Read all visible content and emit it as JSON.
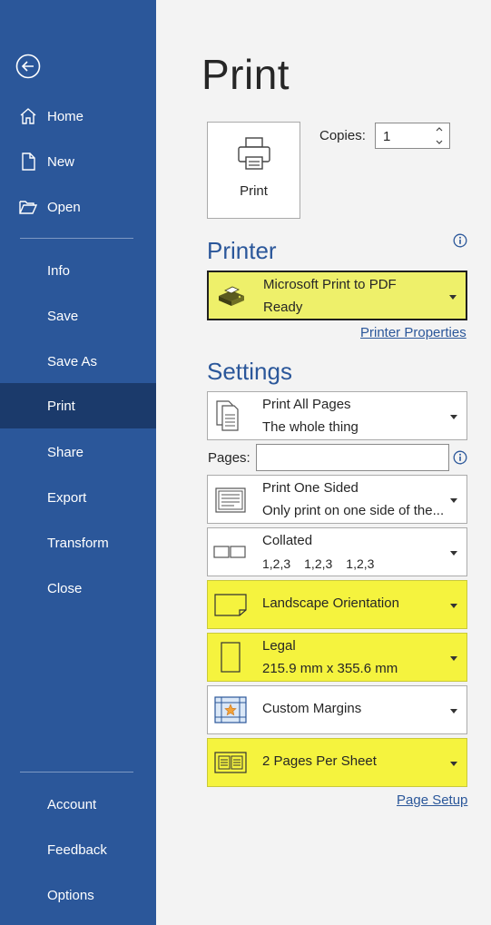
{
  "sidebar": {
    "top_items": [
      {
        "label": "Home",
        "icon": "home-icon"
      },
      {
        "label": "New",
        "icon": "new-document-icon"
      },
      {
        "label": "Open",
        "icon": "open-folder-icon"
      }
    ],
    "mid_items": [
      "Info",
      "Save",
      "Save As",
      "Print",
      "Share",
      "Export",
      "Transform",
      "Close"
    ],
    "active": "Print",
    "bottom_items": [
      "Account",
      "Feedback",
      "Options"
    ]
  },
  "main": {
    "title": "Print",
    "print_button_label": "Print",
    "copies_label": "Copies:",
    "copies_value": "1"
  },
  "printer": {
    "heading": "Printer",
    "name": "Microsoft Print to PDF",
    "status": "Ready",
    "properties_link": "Printer Properties"
  },
  "settings": {
    "heading": "Settings",
    "print_pages": {
      "line1": "Print All Pages",
      "line2": "The whole thing"
    },
    "pages_label": "Pages:",
    "pages_value": "",
    "sides": {
      "line1": "Print One Sided",
      "line2": "Only print on one side of the..."
    },
    "collation": {
      "line1": "Collated",
      "line2": [
        "1,2,3",
        "1,2,3",
        "1,2,3"
      ]
    },
    "orientation": {
      "line1": "Landscape Orientation"
    },
    "paper": {
      "line1": "Legal",
      "line2": "215.9 mm x 355.6 mm"
    },
    "margins": {
      "line1": "Custom Margins"
    },
    "per_sheet": {
      "line1": "2 Pages Per Sheet"
    },
    "page_setup_link": "Page Setup"
  },
  "colors": {
    "sidebar": "#2b579a",
    "sidebar_active": "#1b3a6b",
    "highlight": "#f5f33e",
    "accent": "#2b579a"
  }
}
